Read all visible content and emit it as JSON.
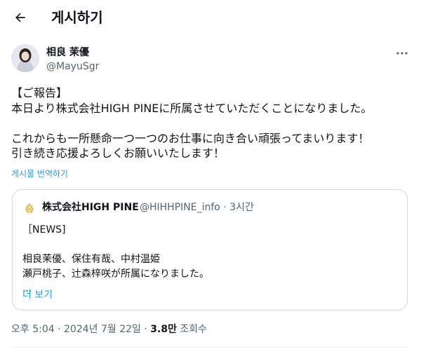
{
  "header": {
    "title": "게시하기"
  },
  "author": {
    "display_name": "相良 茉優",
    "handle": "@MayuSgr"
  },
  "tweet": {
    "lines": [
      "【ご報告】",
      "本日より株式会社HIGH PINEに所属させていただくことになりました。",
      "",
      "これからも一所懸命一つ一つのお仕事に向き合い頑張ってまいります！",
      "引き続き応援よろしくお願いいたします！"
    ],
    "translate_label": "게시물 번역하기"
  },
  "quote": {
    "name": "株式会社HIGH PINE",
    "handle": "@HIHHPINE_info",
    "separator": "·",
    "time": "3시간",
    "lines": [
      "［NEWS]",
      "",
      "相良茉優、保住有哉、中村温姫",
      "瀬戸桃子、辻森梓咲が所属になりました。",
      "..."
    ],
    "show_more": "더 보기"
  },
  "footer": {
    "time": "오후 5:04",
    "sep1": "·",
    "date": "2024년 7월 22일",
    "sep2": "·",
    "views": "3.8만",
    "views_label": "조회수"
  },
  "icons": {
    "back": "back-arrow-icon",
    "more": "more-dots-icon"
  }
}
